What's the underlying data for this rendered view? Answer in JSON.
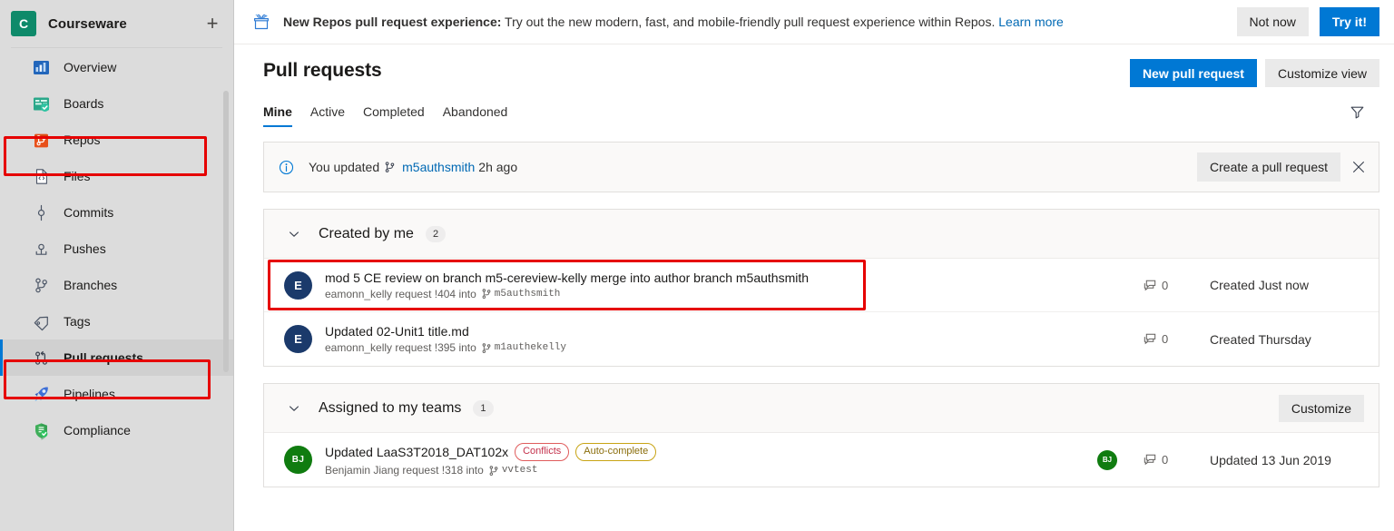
{
  "sidebar": {
    "project": {
      "initial": "C",
      "name": "Courseware",
      "add_label": "+",
      "logo_color": "#0e8a6a"
    },
    "items": [
      {
        "label": "Overview",
        "icon": "overview-icon",
        "selected": false
      },
      {
        "label": "Boards",
        "icon": "boards-icon",
        "selected": false
      },
      {
        "label": "Repos",
        "icon": "repos-icon",
        "selected": false,
        "highlighted": true
      },
      {
        "label": "Files",
        "icon": "files-icon",
        "selected": false
      },
      {
        "label": "Commits",
        "icon": "commits-icon",
        "selected": false
      },
      {
        "label": "Pushes",
        "icon": "pushes-icon",
        "selected": false
      },
      {
        "label": "Branches",
        "icon": "branches-icon",
        "selected": false
      },
      {
        "label": "Tags",
        "icon": "tags-icon",
        "selected": false
      },
      {
        "label": "Pull requests",
        "icon": "pull-requests-icon",
        "selected": true,
        "highlighted": true
      },
      {
        "label": "Pipelines",
        "icon": "pipelines-icon",
        "selected": false
      },
      {
        "label": "Compliance",
        "icon": "compliance-icon",
        "selected": false
      }
    ]
  },
  "banner": {
    "icon": "new-feature-gift-icon",
    "bold_text": "New Repos pull request experience:",
    "body_text": " Try out the new modern, fast, and mobile-friendly pull request experience within Repos. ",
    "link_text": "Learn more",
    "dismiss_label": "Not now",
    "accept_label": "Try it!"
  },
  "header": {
    "title": "Pull requests",
    "new_pr_label": "New pull request",
    "customize_view_label": "Customize view",
    "filter_icon": "filter-icon"
  },
  "tabs": [
    {
      "label": "Mine",
      "active": true
    },
    {
      "label": "Active",
      "active": false
    },
    {
      "label": "Completed",
      "active": false
    },
    {
      "label": "Abandoned",
      "active": false
    }
  ],
  "info_message": {
    "icon": "info-circle-icon",
    "prefix": "You updated",
    "branch": "m5authsmith",
    "suffix": "2h ago",
    "action_label": "Create a pull request",
    "close_icon": "close-icon"
  },
  "groups": [
    {
      "title": "Created by me",
      "count": "2",
      "chevron": "chevron-down-icon",
      "action_label": null,
      "rows": [
        {
          "avatar_initials": "E",
          "avatar_color": "#1b3a6b",
          "title": "mod 5 CE review on branch m5-cereview-kelly merge into author branch m5authsmith",
          "sub_author": "eamonn_kelly",
          "sub_request": "request !404 into",
          "sub_branch": "m5authsmith",
          "pills": [],
          "reviewer": null,
          "comments": "0",
          "date": "Created Just now",
          "highlighted": true
        },
        {
          "avatar_initials": "E",
          "avatar_color": "#1b3a6b",
          "title": "Updated 02-Unit1 title.md",
          "sub_author": "eamonn_kelly",
          "sub_request": "request !395 into",
          "sub_branch": "m1authekelly",
          "pills": [],
          "reviewer": null,
          "comments": "0",
          "date": "Created Thursday",
          "highlighted": false
        }
      ]
    },
    {
      "title": "Assigned to my teams",
      "count": "1",
      "chevron": "chevron-down-icon",
      "action_label": "Customize",
      "rows": [
        {
          "avatar_initials": "BJ",
          "avatar_color": "#107c10",
          "title": "Updated LaaS3T2018_DAT102x",
          "sub_author": "Benjamin Jiang",
          "sub_request": "request !318 into",
          "sub_branch": "vvtest",
          "pills": [
            {
              "label": "Conflicts",
              "kind": "conflicts"
            },
            {
              "label": "Auto-complete",
              "kind": "autocomplete"
            }
          ],
          "reviewer": {
            "initials": "BJ",
            "color": "#107c10",
            "status": "approved"
          },
          "comments": "0",
          "date": "Updated 13 Jun 2019",
          "highlighted": false
        }
      ]
    }
  ],
  "colors": {
    "accent": "#0078d4",
    "link": "#0069b4",
    "highlight_box": "#e60000",
    "sidebar_bg": "#dcdcdc",
    "conflicts": "#c4314b",
    "autocomplete": "#8a6d0b",
    "approved": "#107c10"
  }
}
